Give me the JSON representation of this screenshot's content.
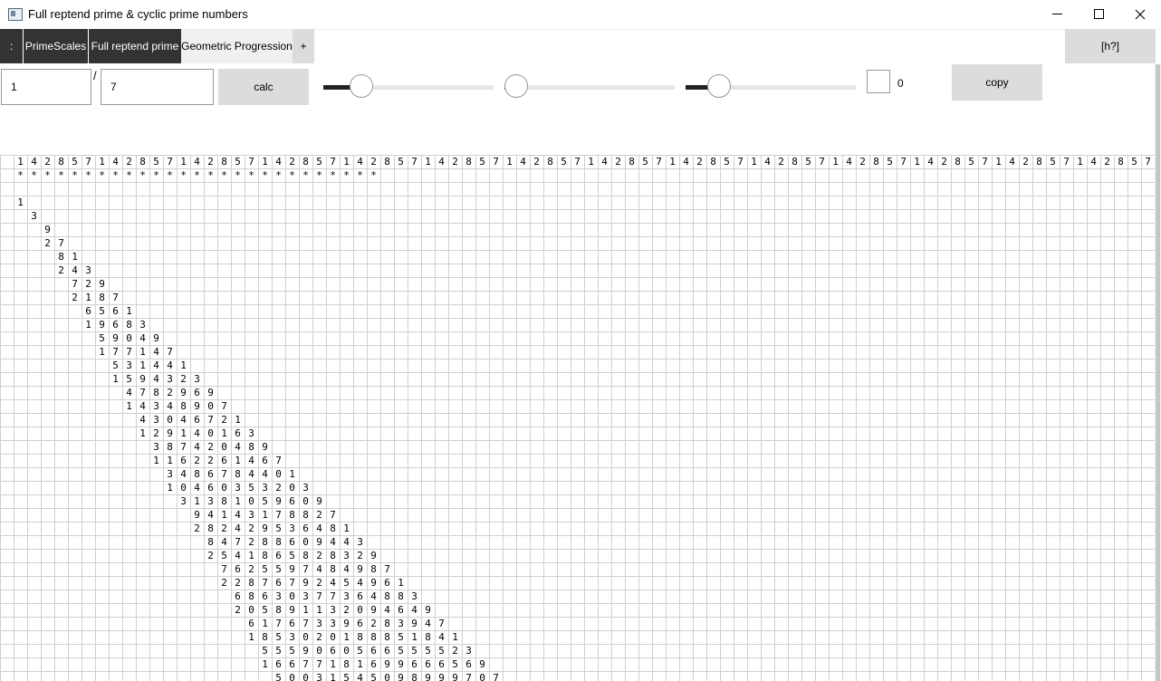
{
  "window": {
    "title": "Full reptend prime & cyclic prime numbers",
    "icon": "app-window-icon"
  },
  "tabs": [
    {
      "label": ":",
      "style": "dark"
    },
    {
      "label": "PrimeScales",
      "style": "dark"
    },
    {
      "label": "Full reptend prime",
      "style": "dark"
    },
    {
      "label": "Geometric Progression",
      "style": "active"
    },
    {
      "label": "+",
      "style": "light"
    }
  ],
  "help_label": "[h?]",
  "controls": {
    "numerator": "1",
    "slash": "/",
    "denominator": "7",
    "calc_label": "calc",
    "copy_label": "copy",
    "count_value": "0",
    "checkbox_checked": false,
    "sliders": [
      {
        "name": "slider-1",
        "level": 0.18
      },
      {
        "name": "slider-2",
        "level": 0.0
      },
      {
        "name": "slider-3",
        "level": 0.15
      }
    ]
  },
  "grid": {
    "repetend_row": "142857142857142857142857142857142857142857142857142857142857142857142857142857142857",
    "marker_row": "***************************",
    "rows": [
      {
        "offset": 1,
        "digits": "1"
      },
      {
        "offset": 2,
        "digits": "3"
      },
      {
        "offset": 3,
        "digits": "9"
      },
      {
        "offset": 3,
        "digits": "27"
      },
      {
        "offset": 4,
        "digits": "81"
      },
      {
        "offset": 4,
        "digits": "243"
      },
      {
        "offset": 5,
        "digits": "729"
      },
      {
        "offset": 5,
        "digits": "2187"
      },
      {
        "offset": 6,
        "digits": "6561"
      },
      {
        "offset": 6,
        "digits": "19683"
      },
      {
        "offset": 7,
        "digits": "59049"
      },
      {
        "offset": 7,
        "digits": "177147"
      },
      {
        "offset": 8,
        "digits": "531441"
      },
      {
        "offset": 8,
        "digits": "1594323"
      },
      {
        "offset": 9,
        "digits": "4782969"
      },
      {
        "offset": 9,
        "digits": "14348907"
      },
      {
        "offset": 10,
        "digits": "43046721"
      },
      {
        "offset": 10,
        "digits": "129140163"
      },
      {
        "offset": 11,
        "digits": "387420489"
      },
      {
        "offset": 11,
        "digits": "1162261467"
      },
      {
        "offset": 12,
        "digits": "3486784401"
      },
      {
        "offset": 12,
        "digits": "10460353203"
      },
      {
        "offset": 13,
        "digits": "31381059609"
      },
      {
        "offset": 14,
        "digits": "94143178827"
      },
      {
        "offset": 14,
        "digits": "282429536481"
      },
      {
        "offset": 15,
        "digits": "847288609443"
      },
      {
        "offset": 15,
        "digits": "2541865828329"
      },
      {
        "offset": 16,
        "digits": "7625597484987"
      },
      {
        "offset": 16,
        "digits": "22876792454961"
      },
      {
        "offset": 17,
        "digits": "68630377364883"
      },
      {
        "offset": 17,
        "digits": "205891132094649"
      },
      {
        "offset": 18,
        "digits": "617673396283947"
      },
      {
        "offset": 18,
        "digits": "1853020188851841"
      },
      {
        "offset": 19,
        "digits": "5559060566555523"
      },
      {
        "offset": 19,
        "digits": "16677181699666569"
      },
      {
        "offset": 20,
        "digits": "50031545098999707"
      }
    ]
  }
}
